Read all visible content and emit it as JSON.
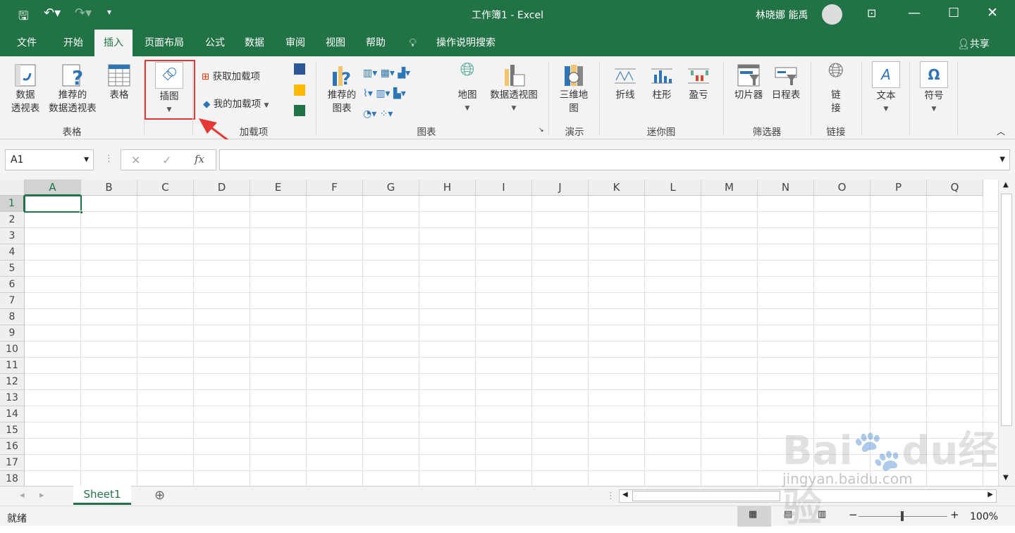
{
  "title": "工作簿1 - Excel",
  "user": "林晓娜 能禹",
  "tabs": [
    "文件",
    "开始",
    "插入",
    "页面布局",
    "公式",
    "数据",
    "审阅",
    "视图",
    "帮助"
  ],
  "tell_me": "操作说明搜索",
  "share": "共享",
  "ribbon": {
    "pivot": "数据\n透视表",
    "rec_pivot": "推荐的\n数据透视表",
    "table": "表格",
    "group_tables": "表格",
    "illustrations": "插图",
    "get_addins": "获取加载项",
    "my_addins": "我的加载项",
    "group_addins": "加载项",
    "rec_charts": "推荐的\n图表",
    "maps": "地图",
    "pivot_chart": "数据透视图",
    "group_charts": "图表",
    "map3d": "三维地\n图",
    "group_tours": "演示",
    "line": "折线",
    "column": "柱形",
    "winloss": "盈亏",
    "group_spark": "迷你图",
    "slicer": "切片器",
    "timeline": "日程表",
    "group_filters": "筛选器",
    "link": "链\n接",
    "group_links": "链接",
    "text": "文本",
    "symbols": "符号"
  },
  "namebox": "A1",
  "fx": "fx",
  "columns": [
    "A",
    "B",
    "C",
    "D",
    "E",
    "F",
    "G",
    "H",
    "I",
    "J",
    "K",
    "L",
    "M",
    "N",
    "O",
    "P",
    "Q"
  ],
  "rows": [
    "1",
    "2",
    "3",
    "4",
    "5",
    "6",
    "7",
    "8",
    "9",
    "10",
    "11",
    "12",
    "13",
    "14",
    "15",
    "16",
    "17",
    "18"
  ],
  "sheet": "Sheet1",
  "status": "就绪",
  "zoom": "100%",
  "watermark": "Baidu经验 jingyan.baidu.com",
  "colors": {
    "accent": "#217346",
    "highlight": "#e53935"
  }
}
